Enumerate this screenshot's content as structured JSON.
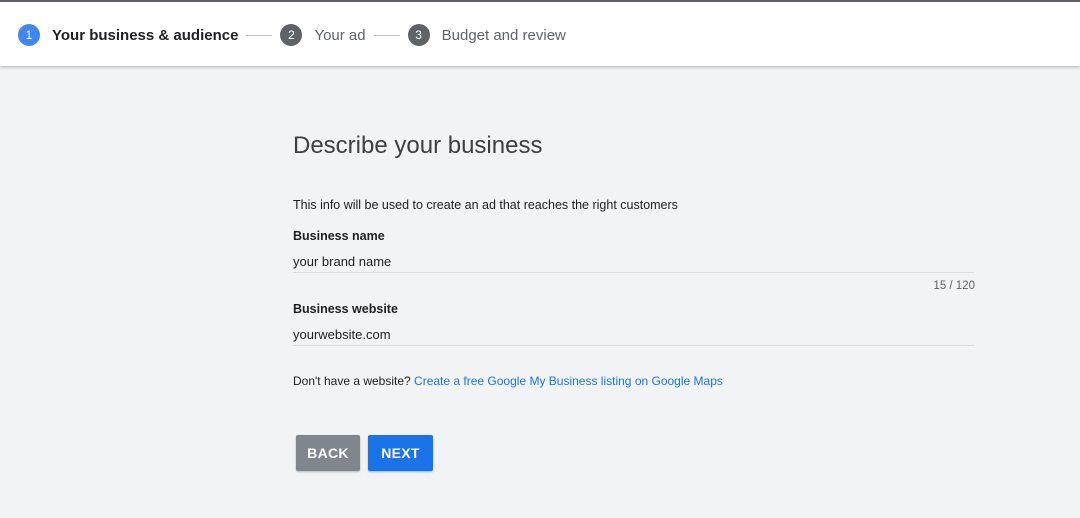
{
  "stepper": {
    "steps": [
      {
        "number": "1",
        "label": "Your business & audience",
        "active": true
      },
      {
        "number": "2",
        "label": "Your ad",
        "active": false
      },
      {
        "number": "3",
        "label": "Budget and review",
        "active": false
      }
    ]
  },
  "form": {
    "title": "Describe your business",
    "subtitle": "This info will be used to create an ad that reaches the right customers",
    "business_name": {
      "label": "Business name",
      "value": "your brand name",
      "counter": "15 / 120"
    },
    "business_website": {
      "label": "Business website",
      "value": "yourwebsite.com"
    },
    "website_help": {
      "text": "Don't have a website?",
      "link": "Create a free Google My Business listing on Google Maps"
    }
  },
  "actions": {
    "back_label": "BACK",
    "next_label": "NEXT"
  },
  "colors": {
    "accent": "#1a73e8",
    "active_step": "#4285f4",
    "background": "#f1f3f4",
    "back_button": "#80868b"
  }
}
